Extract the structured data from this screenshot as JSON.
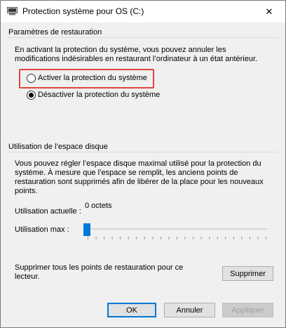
{
  "window": {
    "title": "Protection système pour OS (C:)",
    "icon": "computer-icon",
    "close_symbol": "✕"
  },
  "restore_settings": {
    "group_title": "Paramètres de restauration",
    "description": "En activant la protection du système, vous pouvez annuler les modifications indésirables en restaurant l’ordinateur à un état antérieur.",
    "options": [
      {
        "label": "Activer la protection du système",
        "checked": false
      },
      {
        "label": "Désactiver la protection du système",
        "checked": true
      }
    ]
  },
  "disk_usage": {
    "group_title": "Utilisation de l’espace disque",
    "description": "Vous pouvez régler l’espace disque maximal utilisé pour la protection du système. À mesure que l’espace se remplit, les anciens points de restauration sont supprimés afin de libérer de la place pour les nouveaux points.",
    "current_label": "Utilisation actuelle :",
    "current_value": "0 octets",
    "max_label": "Utilisation max :",
    "max_slider_value": 0,
    "delete_text": "Supprimer tous les points de restauration pour ce lecteur.",
    "delete_button": "Supprimer"
  },
  "footer": {
    "ok": "OK",
    "cancel": "Annuler",
    "apply": "Appliquer"
  },
  "colors": {
    "accent": "#0078d7",
    "highlight": "#e0463e"
  }
}
